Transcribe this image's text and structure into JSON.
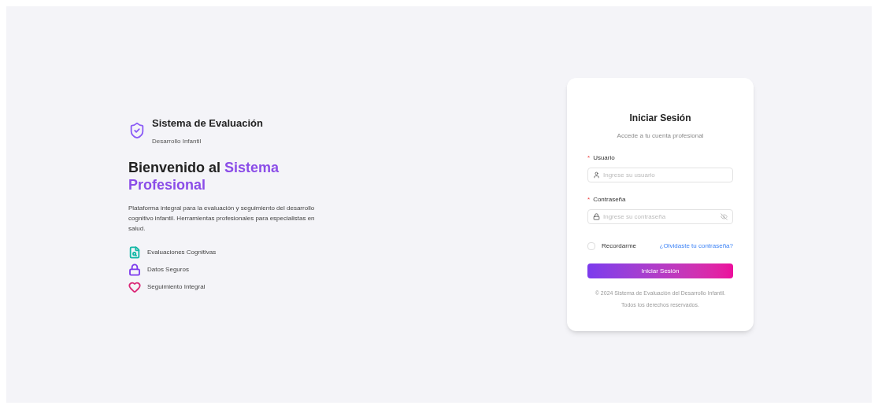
{
  "brand": {
    "title": "Sistema de Evaluación",
    "subtitle": "Desarrollo Infantil"
  },
  "hero": {
    "title": "Bienvenido al",
    "highlight": "Sistema Profesional",
    "description": "Plataforma integral para la evaluación y seguimiento del desarrollo cognitivo infantil. Herramientas profesionales para especialistas en salud."
  },
  "features": [
    {
      "kind": "evaluation",
      "label": "Evaluaciones Cognitivas",
      "color": "#14b8a6"
    },
    {
      "kind": "security",
      "label": "Datos Seguros",
      "color": "#7c3aed"
    },
    {
      "kind": "tracking",
      "label": "Seguimiento Integral",
      "color": "#db2777"
    }
  ],
  "login": {
    "title": "Iniciar Sesión",
    "subtitle": "Accede a tu cuenta profesional",
    "fields": [
      {
        "kind": "user",
        "label": "Usuario",
        "required": true,
        "required_mark": "*",
        "placeholder": "Ingrese su usuario"
      },
      {
        "kind": "password",
        "label": "Contraseña",
        "required": true,
        "required_mark": "*",
        "placeholder": "Ingrese su contraseña"
      }
    ],
    "remember": {
      "label": "Recordarme",
      "checked": false
    },
    "forgot": "¿Olvidaste tu contraseña?",
    "submit": "Iniciar Sesión",
    "footer": [
      "© 2024 Sistema de Evaluación del Desarrollo Infantil.",
      "Todos los derechos reservados."
    ]
  }
}
